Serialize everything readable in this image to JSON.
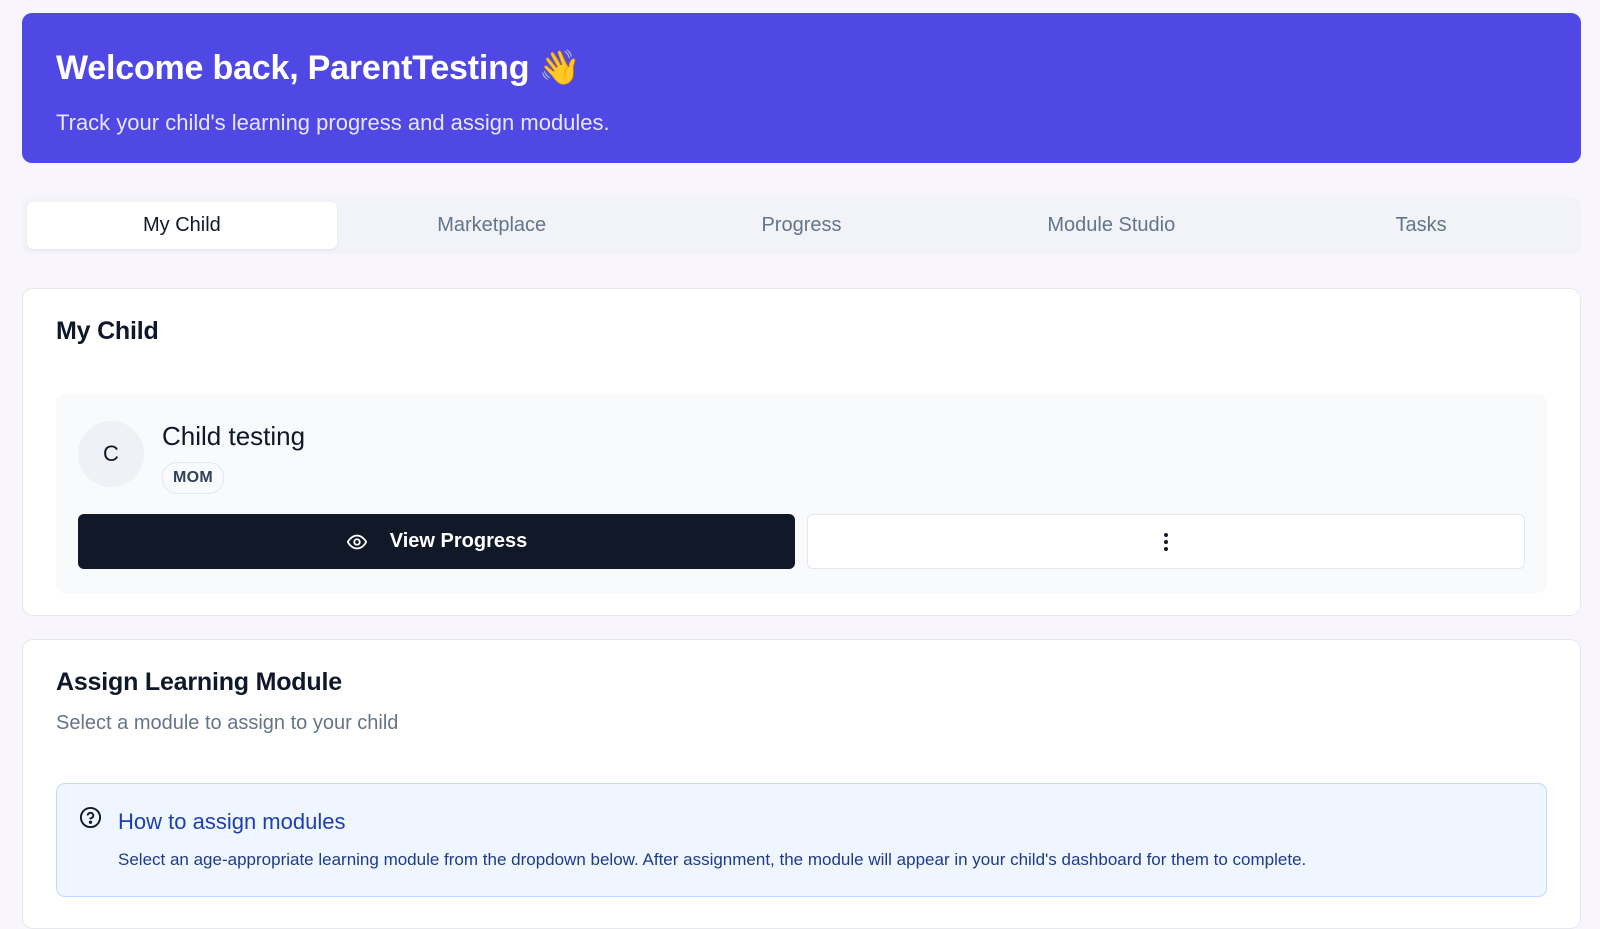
{
  "header": {
    "title": "Welcome back, ParentTesting 👋",
    "subtitle": "Track your child's learning progress and assign modules."
  },
  "tabs": [
    {
      "label": "My Child",
      "active": true
    },
    {
      "label": "Marketplace",
      "active": false
    },
    {
      "label": "Progress",
      "active": false
    },
    {
      "label": "Module Studio",
      "active": false
    },
    {
      "label": "Tasks",
      "active": false
    }
  ],
  "my_child": {
    "title": "My Child",
    "child": {
      "avatar_initial": "C",
      "name": "Child testing",
      "role": "MOM"
    },
    "view_progress_label": "View Progress",
    "icons": {
      "view_progress": "eye-icon",
      "more": "more-vertical-icon"
    }
  },
  "assign_module": {
    "title": "Assign Learning Module",
    "subtitle": "Select a module to assign to your child",
    "help": {
      "icon": "help-circle-icon",
      "title": "How to assign modules",
      "text": "Select an age-appropriate learning module from the dropdown below. After assignment, the module will appear in your child's dashboard for them to complete."
    }
  },
  "colors": {
    "brand": "#5048e5",
    "page_background": "#f8f5fd",
    "primary_button": "#111827",
    "help_background": "#eff6ff",
    "help_text": "#1e40af"
  }
}
